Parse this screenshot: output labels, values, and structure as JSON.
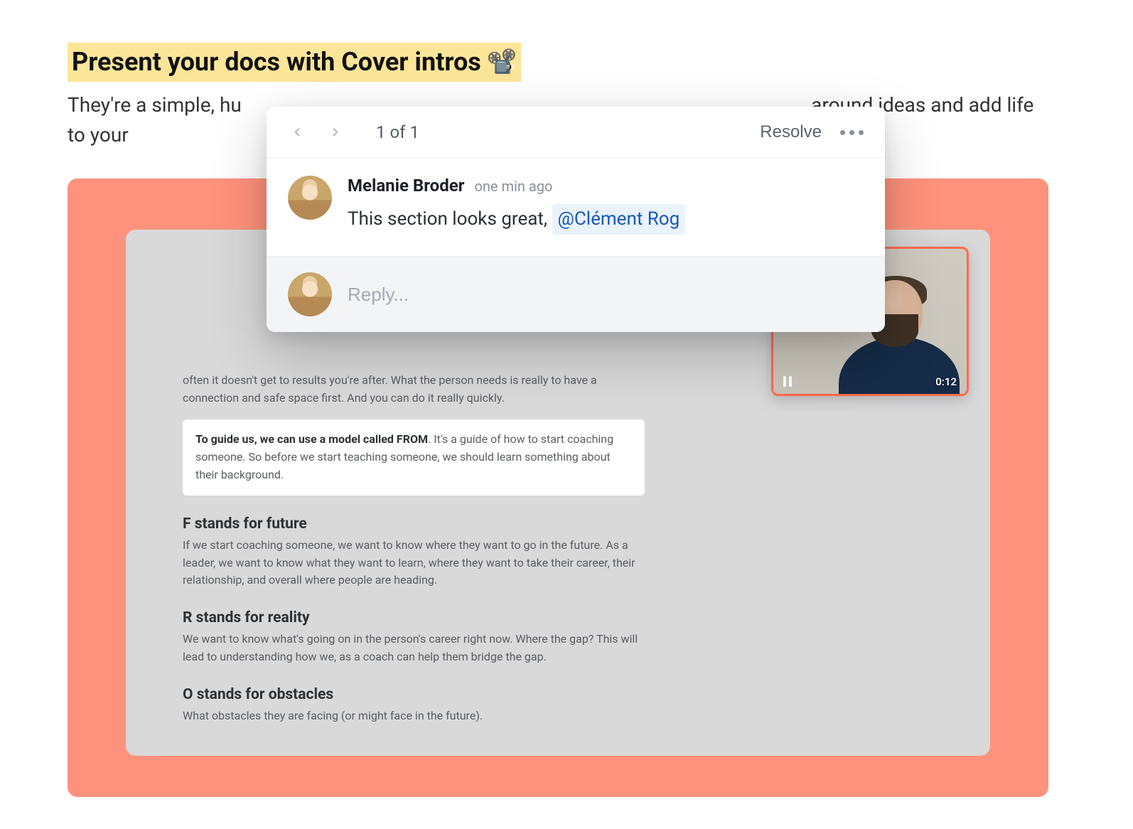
{
  "header": {
    "title": "Present your docs with Cover intros",
    "title_emoji": "📽️",
    "subtitle_before": "They're a simple, hu",
    "subtitle_after": " around ideas and add life to your"
  },
  "popover": {
    "counter": "1 of 1",
    "resolve_label": "Resolve",
    "comment": {
      "author": "Melanie Broder",
      "time": "one min ago",
      "text": "This section looks great, ",
      "mention": "@Clément Rog"
    },
    "reply_placeholder": "Reply..."
  },
  "doc": {
    "intro_tail": "often it doesn't get to results you're after. What the person needs is really to have a connection and safe space first. And you can do it really quickly.",
    "box_lead": "To guide us, we can use a model called FROM",
    "box_rest": ". It's a guide of how to start coaching someone. So before we start teaching someone, we should learn something about their background.",
    "sections": [
      {
        "heading": "F stands for future",
        "body": "If we start coaching someone, we want to know where they want to go in the future. As a leader, we want to know what they want to learn, where they want to take their career, their relationship, and overall where people are heading."
      },
      {
        "heading": "R stands for reality",
        "body": "We want to know what's going on in the person's career right now. Where the gap? This will lead to understanding how we, as a coach can help them bridge the gap."
      },
      {
        "heading": "O stands for obstacles",
        "body": "What obstacles they are facing (or might face in the future)."
      }
    ]
  },
  "video": {
    "timestamp": "0:12"
  }
}
